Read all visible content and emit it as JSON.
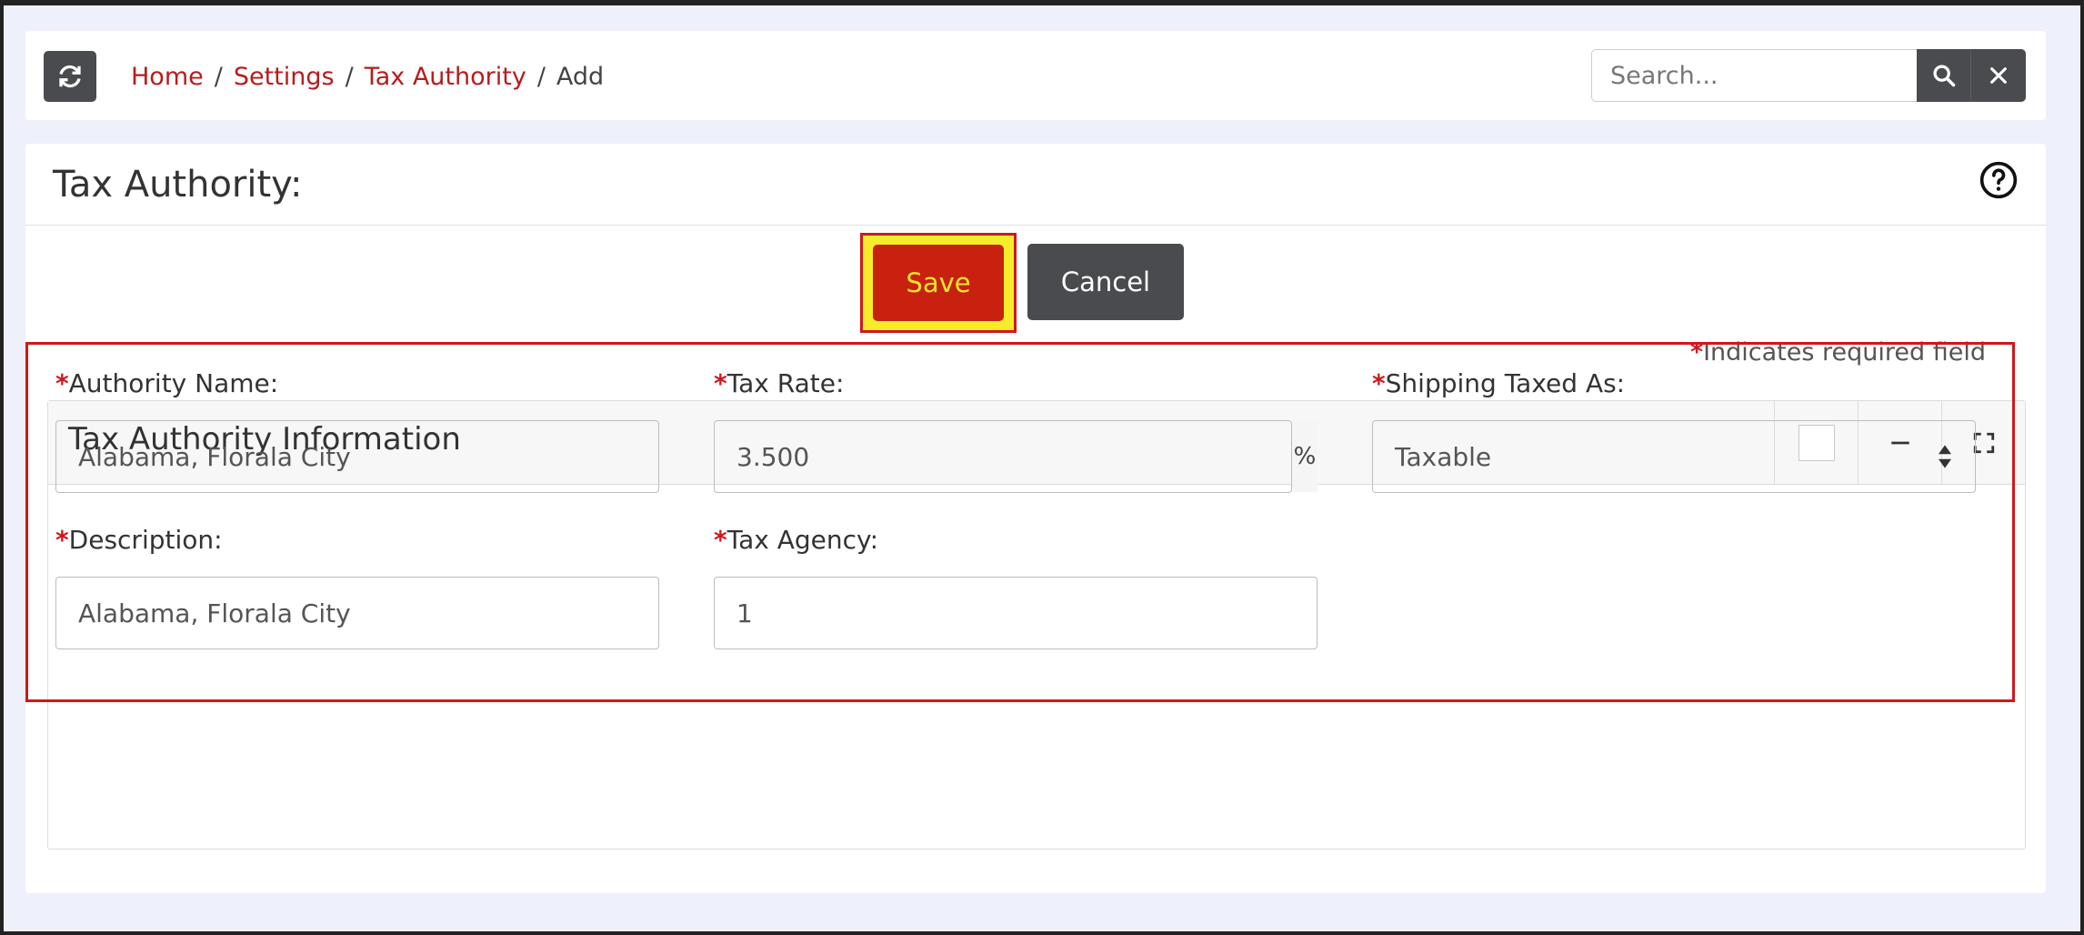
{
  "breadcrumb": {
    "home": "Home",
    "settings": "Settings",
    "tax_authority": "Tax Authority",
    "current": "Add",
    "separator": "/"
  },
  "search": {
    "placeholder": "Search..."
  },
  "page": {
    "title": "Tax Authority:"
  },
  "actions": {
    "save": "Save",
    "cancel": "Cancel"
  },
  "required_note": {
    "star": "*",
    "text": "Indicates required field"
  },
  "panel": {
    "title": "Tax Authority Information"
  },
  "form": {
    "authority_name": {
      "label": "Authority Name:",
      "value": "Alabama, Florala City"
    },
    "tax_rate": {
      "label": "Tax Rate:",
      "value": "3.500",
      "unit": "%"
    },
    "shipping_taxed_as": {
      "label": "Shipping Taxed As:",
      "value": "Taxable"
    },
    "description": {
      "label": "Description:",
      "value": "Alabama, Florala City"
    },
    "tax_agency": {
      "label": "Tax Agency:",
      "value": "1"
    }
  },
  "colors": {
    "accent_red": "#b71c1c",
    "highlight_yellow": "#f4e62c",
    "dark_button": "#4a4b4f"
  },
  "icons": [
    "refresh-icon",
    "search-icon",
    "close-icon",
    "help-icon",
    "minimize-icon",
    "expand-icon"
  ]
}
